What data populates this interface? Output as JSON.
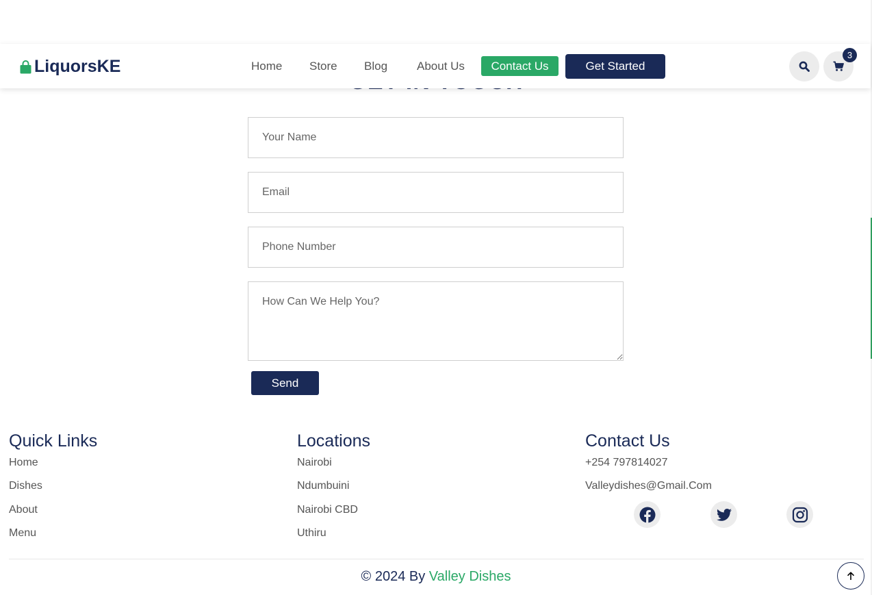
{
  "page": {
    "heading": "GET IN TOUCH"
  },
  "navbar": {
    "brand": "LiquorsKE",
    "brand_icon": "shopping-bag-icon",
    "links": [
      "Home",
      "Store",
      "Blog",
      "About Us"
    ],
    "contact_button": "Contact Us",
    "get_started_button": "Get Started",
    "search_icon": "search-icon",
    "cart_icon": "cart-icon",
    "cart_count": "3"
  },
  "contact_form": {
    "name_placeholder": "Your Name",
    "email_placeholder": "Email",
    "phone_placeholder": "Phone Number",
    "message_placeholder": "How Can We Help You?",
    "send_button": "Send"
  },
  "footer": {
    "quick_links": {
      "title": "Quick Links",
      "items": [
        "Home",
        "Dishes",
        "About",
        "Menu"
      ]
    },
    "locations": {
      "title": "Locations",
      "items": [
        "Nairobi",
        "Ndumbuini",
        "Nairobi CBD",
        "Uthiru"
      ]
    },
    "contact": {
      "title": "Contact Us",
      "phone": "+254 797814027",
      "email": "Valleydishes@Gmail.Com",
      "social_icons": [
        "facebook-icon",
        "twitter-icon",
        "instagram-icon"
      ]
    },
    "copyright_prefix": "© 2024 By ",
    "copyright_brand": "Valley Dishes",
    "back_to_top_icon": "arrow-up-icon"
  },
  "colors": {
    "primary_navy": "#1a2a57",
    "accent_green": "#2aa866",
    "text_gray": "#555555"
  }
}
